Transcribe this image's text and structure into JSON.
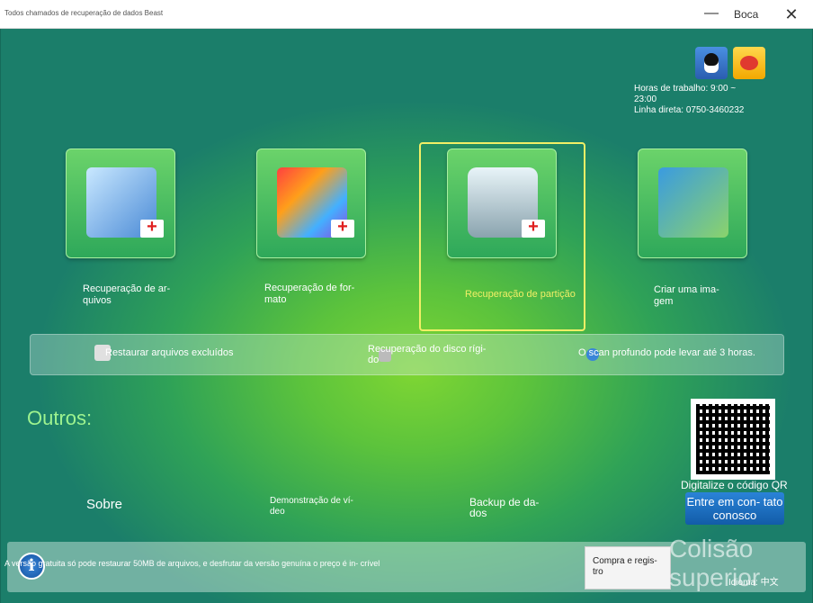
{
  "window": {
    "title": "Todos chamados de recuperação de dados Beast",
    "minimize": "—",
    "close_label": "Boca",
    "close_x": "✕"
  },
  "contact_info": {
    "hours": "Horas de trabalho: 9:00 ~ 23:00",
    "hotline": "Linha direta: 0750-3460232"
  },
  "tiles": [
    {
      "label": "Recuperação de ar- quivos",
      "icon": "recycle-bin-folder-icon"
    },
    {
      "label": "Recuperação de for- mato",
      "icon": "format-boxes-icon"
    },
    {
      "label": "Recuperação de partição",
      "icon": "hard-disk-icon",
      "selected": true
    },
    {
      "label": "Criar uma ima- gem",
      "icon": "image-backup-icon"
    }
  ],
  "modes": {
    "restore": "Restaurar arquivos excluídos",
    "disk": "Recuperação do disco rígi- do",
    "scan": "O scan profundo pode levar até 3 horas."
  },
  "others": {
    "heading": "Outros:",
    "about": "Sobre",
    "demo": "Demonstração de ví- deo",
    "backup": "Backup de da- dos"
  },
  "qr": {
    "caption": "Digitalize o código QR",
    "contact": "Entre em con- tato conosco"
  },
  "footer": {
    "notice": "A versão gratuita só pode restaurar 50MB de arquivos, e desfrutar da versão genuína o preço é in- crível",
    "buy": "Compra e regis- tro",
    "collision": "Colisão superior",
    "language": "Idioma: 中文"
  },
  "colors": {
    "accent_selected": "#f1ef66",
    "heading_green": "#9ef38f"
  }
}
